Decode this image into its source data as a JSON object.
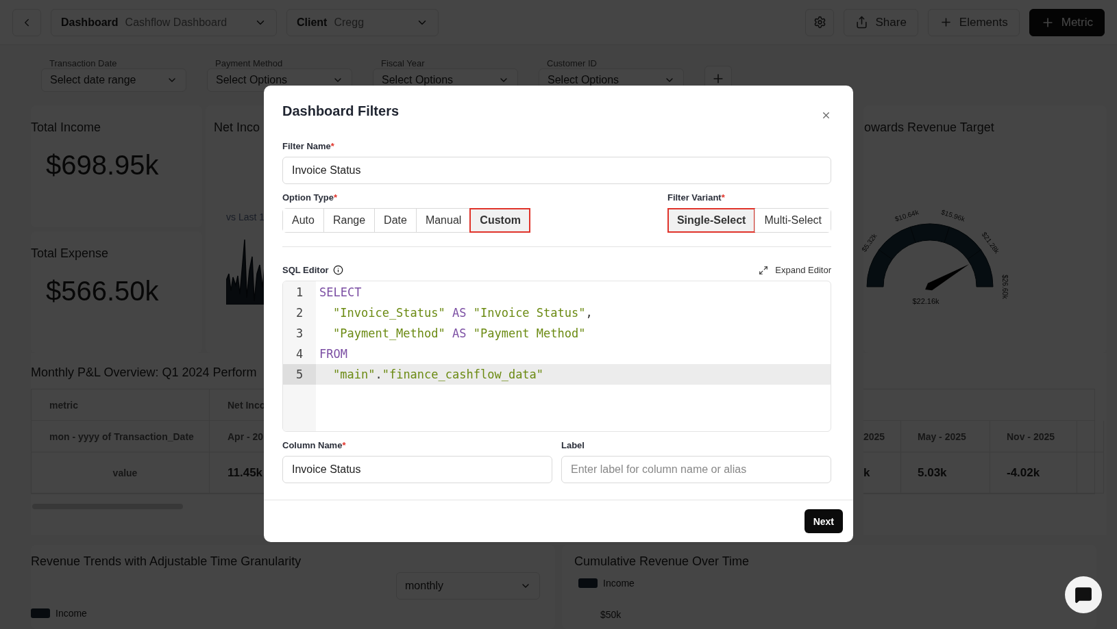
{
  "top_bar": {
    "dashboard_select": {
      "label": "Dashboard",
      "value": "Cashflow Dashboard"
    },
    "client_select": {
      "label": "Client",
      "value": "Cregg"
    },
    "buttons": [
      {
        "kind": "icon"
      },
      {
        "kind": "outline",
        "label": "Share"
      },
      {
        "kind": "outline",
        "label": "Elements"
      },
      {
        "kind": "primary",
        "label": "Metric"
      }
    ]
  },
  "filters": [
    {
      "label": "Transaction Date",
      "placeholder": "Select date range"
    },
    {
      "label": "Payment Method",
      "placeholder": "Select Options"
    },
    {
      "label": "Fiscal Year",
      "placeholder": "Select Options"
    },
    {
      "label": "Customer ID",
      "placeholder": "Select Options"
    }
  ],
  "kpis": [
    {
      "title": "Total Income",
      "value": "$698.95k"
    },
    {
      "title": "Total Expense",
      "value": "$566.50k"
    }
  ],
  "net_income_card": {
    "title": "Net Inco",
    "comparison": "vs Last 1"
  },
  "gauge_card": {
    "title": "owards Revenue Target",
    "ticks": [
      "$5.32k",
      "$10.64k",
      "$15.96k",
      "$21.28k",
      "$26.60k"
    ],
    "value": "$22.16k"
  },
  "pl_table": {
    "title": "Monthly P&L Overview: Q1 2024 Perform",
    "left_rows": [
      [
        "metric",
        "Net Inco"
      ],
      [
        "mon - yyyy of Transaction_Date",
        "Apr - 20"
      ],
      [
        "value",
        "11.45k"
      ]
    ],
    "right_rows": [
      [
        "2025",
        "May - 2025",
        "Nov - 2025"
      ],
      [
        "k",
        "5.03k",
        "-4.02k"
      ]
    ]
  },
  "revenue_trends": {
    "title": "Revenue Trends with Adjustable Time Granularity",
    "granularity": "monthly",
    "legend": "Income"
  },
  "cumulative": {
    "title": "Cumulative Revenue Over Time",
    "legend": "Income",
    "y_tick": "$50k"
  },
  "modal": {
    "title": "Dashboard Filters",
    "filter_name": {
      "label": "Filter Name",
      "required_mark": "*",
      "value": "Invoice Status"
    },
    "option_type": {
      "label": "Option Type",
      "required_mark": "*",
      "options": [
        {
          "label": "Auto",
          "selected": false
        },
        {
          "label": "Range",
          "selected": false
        },
        {
          "label": "Date",
          "selected": false
        },
        {
          "label": "Manual",
          "selected": false
        },
        {
          "label": "Custom",
          "selected": true
        }
      ]
    },
    "filter_variant": {
      "label": "Filter Variant",
      "required_mark": "*",
      "options": [
        {
          "label": "Single-Select",
          "selected": true
        },
        {
          "label": "Multi-Select",
          "selected": false
        }
      ]
    },
    "sql_editor": {
      "label": "SQL Editor",
      "expand": "Expand Editor",
      "lines": [
        {
          "number": "1",
          "indent": false,
          "selected": false,
          "tokens": [
            {
              "kind": "keyword",
              "text": "SELECT"
            }
          ]
        },
        {
          "number": "2",
          "indent": true,
          "selected": false,
          "tokens": [
            {
              "kind": "string",
              "text": "\"Invoice_Status\""
            },
            {
              "kind": "keyword",
              "text": " AS "
            },
            {
              "kind": "string",
              "text": "\"Invoice Status\""
            },
            {
              "kind": "punct",
              "text": ","
            }
          ]
        },
        {
          "number": "3",
          "indent": true,
          "selected": false,
          "tokens": [
            {
              "kind": "string",
              "text": "\"Payment_Method\""
            },
            {
              "kind": "keyword",
              "text": " AS "
            },
            {
              "kind": "string",
              "text": "\"Payment Method\""
            }
          ]
        },
        {
          "number": "4",
          "indent": false,
          "selected": false,
          "tokens": [
            {
              "kind": "keyword",
              "text": "FROM"
            }
          ]
        },
        {
          "number": "5",
          "indent": true,
          "selected": true,
          "tokens": [
            {
              "kind": "string",
              "text": "\"main\""
            },
            {
              "kind": "punct",
              "text": "."
            },
            {
              "kind": "string",
              "text": "\"finance_cashflow_data\""
            }
          ]
        }
      ]
    },
    "column_name": {
      "label": "Column Name",
      "required_mark": "*",
      "value": "Invoice Status"
    },
    "label_field": {
      "label": "Label",
      "placeholder": "Enter label for column name or alias"
    },
    "next": "Next"
  }
}
